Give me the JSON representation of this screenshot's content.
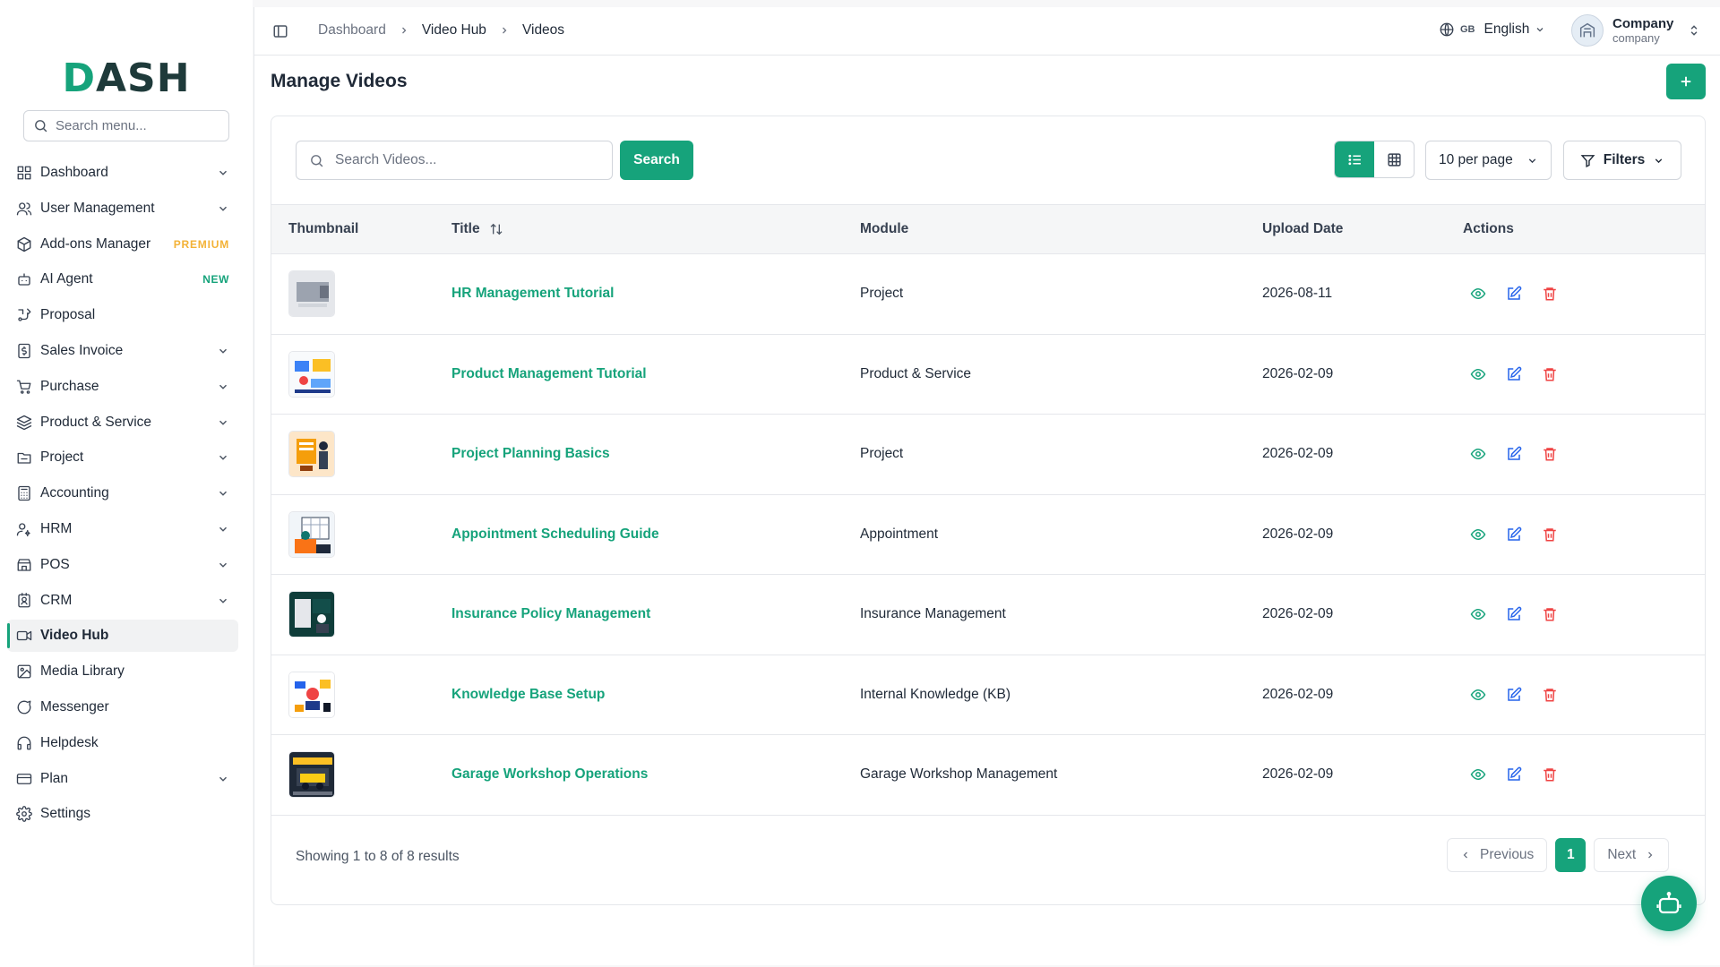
{
  "brand": {
    "logo_text_accent": "D",
    "logo_text_rest": "ASH",
    "accent_color": "#16a37b"
  },
  "sidebar": {
    "search_placeholder": "Search menu...",
    "items": [
      {
        "label": "Dashboard",
        "icon": "grid-icon",
        "expandable": true
      },
      {
        "label": "User Management",
        "icon": "users-icon",
        "expandable": true
      },
      {
        "label": "Add-ons Manager",
        "icon": "package-icon",
        "badge": "PREMIUM"
      },
      {
        "label": "AI Agent",
        "icon": "bot-icon",
        "badge": "NEW"
      },
      {
        "label": "Proposal",
        "icon": "proposal-icon"
      },
      {
        "label": "Sales Invoice",
        "icon": "invoice-icon",
        "expandable": true
      },
      {
        "label": "Purchase",
        "icon": "cart-icon",
        "expandable": true
      },
      {
        "label": "Product & Service",
        "icon": "layers-icon",
        "expandable": true
      },
      {
        "label": "Project",
        "icon": "folder-icon",
        "expandable": true
      },
      {
        "label": "Accounting",
        "icon": "calculator-icon",
        "expandable": true
      },
      {
        "label": "HRM",
        "icon": "user-cog-icon",
        "expandable": true
      },
      {
        "label": "POS",
        "icon": "store-icon",
        "expandable": true
      },
      {
        "label": "CRM",
        "icon": "contact-icon",
        "expandable": true
      },
      {
        "label": "Video Hub",
        "icon": "video-icon",
        "active": true
      },
      {
        "label": "Media Library",
        "icon": "image-icon"
      },
      {
        "label": "Messenger",
        "icon": "message-icon"
      },
      {
        "label": "Helpdesk",
        "icon": "headphones-icon"
      },
      {
        "label": "Plan",
        "icon": "card-icon",
        "expandable": true
      },
      {
        "label": "Settings",
        "icon": "gear-icon"
      }
    ]
  },
  "topbar": {
    "breadcrumb": [
      "Dashboard",
      "Video Hub",
      "Videos"
    ],
    "language_code": "GB",
    "language": "English",
    "user_name": "Company",
    "user_role": "company"
  },
  "page": {
    "title": "Manage Videos",
    "search_placeholder": "Search Videos...",
    "search_button": "Search",
    "per_page": "10 per page",
    "filters_label": "Filters"
  },
  "table": {
    "columns": [
      "Thumbnail",
      "Title",
      "Module",
      "Upload Date",
      "Actions"
    ],
    "rows": [
      {
        "title": "HR Management Tutorial",
        "module": "Project",
        "date": "2026-08-11",
        "thumb": "grey"
      },
      {
        "title": "Product Management Tutorial",
        "module": "Product & Service",
        "date": "2026-02-09",
        "thumb": "office"
      },
      {
        "title": "Project Planning Basics",
        "module": "Project",
        "date": "2026-02-09",
        "thumb": "planning"
      },
      {
        "title": "Appointment Scheduling Guide",
        "module": "Appointment",
        "date": "2026-02-09",
        "thumb": "calendar"
      },
      {
        "title": "Insurance Policy Management",
        "module": "Insurance Management",
        "date": "2026-02-09",
        "thumb": "insurance"
      },
      {
        "title": "Knowledge Base Setup",
        "module": "Internal Knowledge (KB)",
        "date": "2026-02-09",
        "thumb": "knowledge"
      },
      {
        "title": "Garage Workshop Operations",
        "module": "Garage Workshop Management",
        "date": "2026-02-09",
        "thumb": "garage"
      }
    ]
  },
  "footer": {
    "showing": "Showing 1 to 8 of 8 results",
    "previous": "Previous",
    "page": "1",
    "next": "Next"
  }
}
